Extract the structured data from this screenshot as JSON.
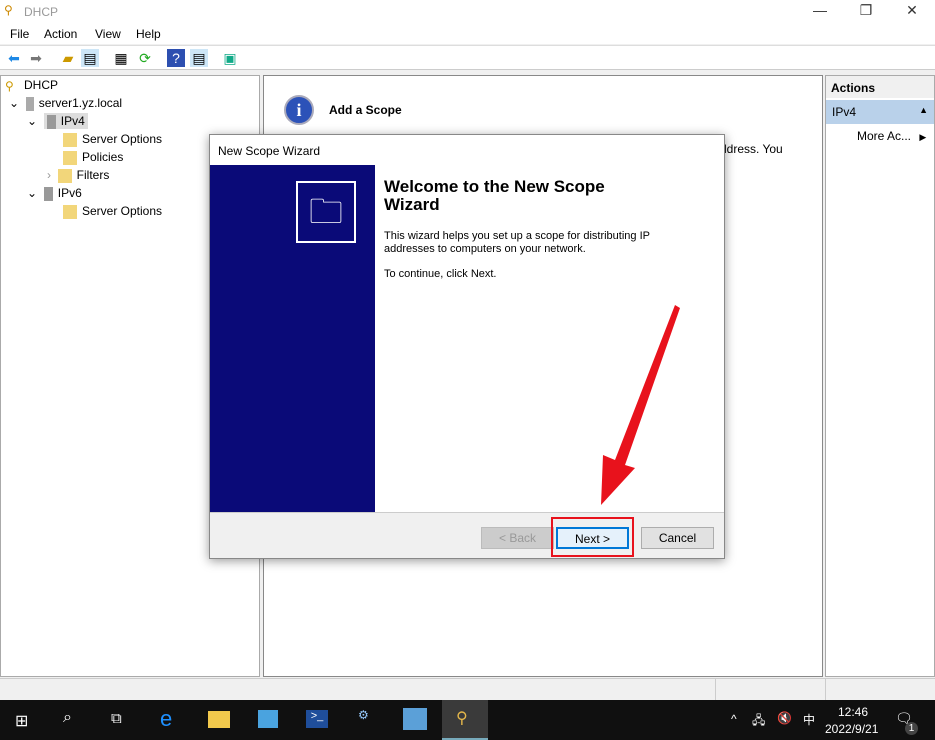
{
  "window": {
    "title": "DHCP",
    "min": "—",
    "max": "❐",
    "close": "✕"
  },
  "menu": [
    "File",
    "Action",
    "View",
    "Help"
  ],
  "tree": {
    "root": "DHCP",
    "server": "server1.yz.local",
    "ipv4": "IPv4",
    "ipv4_children": [
      "Server Options",
      "Policies",
      "Filters"
    ],
    "ipv6": "IPv6",
    "ipv6_children": [
      "Server Options"
    ]
  },
  "center": {
    "heading": "Add a Scope",
    "partial_text": "ldress. You"
  },
  "actions": {
    "header": "Actions",
    "section": "IPv4",
    "more": "More Ac..."
  },
  "wizard": {
    "title": "New Scope Wizard",
    "heading": "Welcome to the New Scope Wizard",
    "body": "This wizard helps you set up a scope for distributing IP addresses to computers on your network.",
    "continue": "To continue, click Next.",
    "back": "< Back",
    "next": "Next >",
    "cancel": "Cancel"
  },
  "taskbar": {
    "time": "12:46",
    "date": "2022/9/21",
    "ime": "中",
    "notifications": "1"
  },
  "colors": {
    "annotation": "#e8121c",
    "banner": "#0a0a78"
  }
}
